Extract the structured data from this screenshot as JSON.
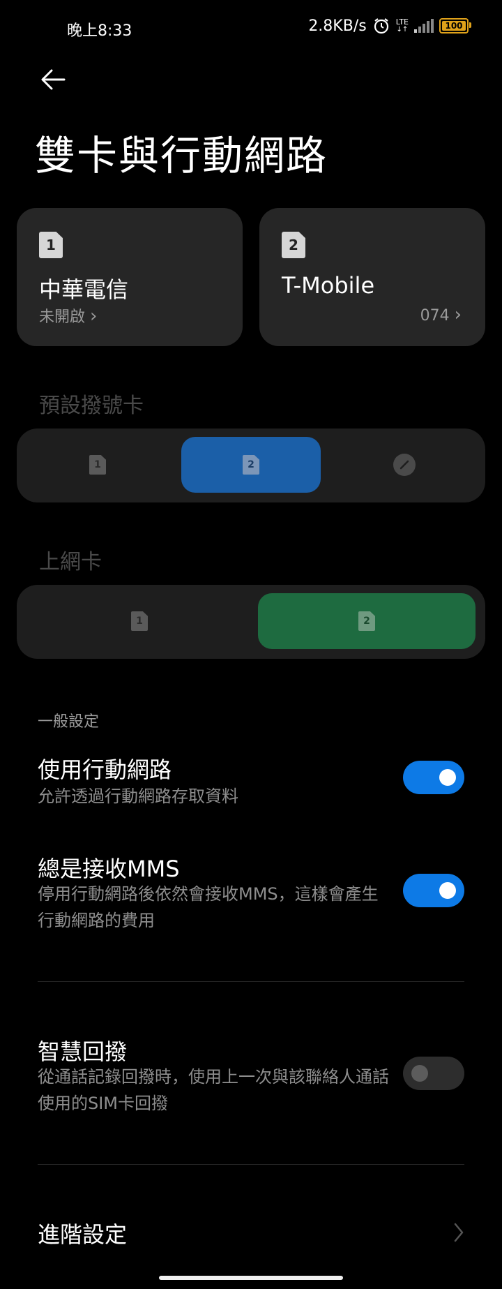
{
  "status_bar": {
    "time": "晚上8:33",
    "net_speed": "2.8KB/s",
    "lte": "LTE",
    "battery": "100"
  },
  "page_title": "雙卡與行動網路",
  "sim_cards": [
    {
      "badge": "1",
      "name": "中華電信",
      "sub": "未開啟",
      "chevron": "›"
    },
    {
      "badge": "2",
      "name": "T-Mobile",
      "sub": "074",
      "chevron": "›"
    }
  ],
  "default_dial": {
    "label": "預設撥號卡",
    "options": [
      "1",
      "2"
    ],
    "selected": "2",
    "accent": "#1b5fa8",
    "edit_icon": "edit-icon"
  },
  "data_sim": {
    "label": "上網卡",
    "options": [
      "1",
      "2"
    ],
    "selected": "2",
    "accent": "#1e6b40"
  },
  "general": {
    "label": "一般設定",
    "items": [
      {
        "title": "使用行動網路",
        "sub": "允許透過行動網路存取資料",
        "toggle": true
      },
      {
        "title": "總是接收MMS",
        "sub": "停用行動網路後依然會接收MMS，這樣會產生行動網路的費用",
        "toggle": true
      },
      {
        "title": "智慧回撥",
        "sub": "從通話記錄回撥時，使用上一次與該聯絡人通話使用的SIM卡回撥",
        "toggle": false
      }
    ]
  },
  "advanced": {
    "label": "進階設定"
  },
  "colors": {
    "toggle_on": "#0d7ae6",
    "background": "#000000"
  }
}
